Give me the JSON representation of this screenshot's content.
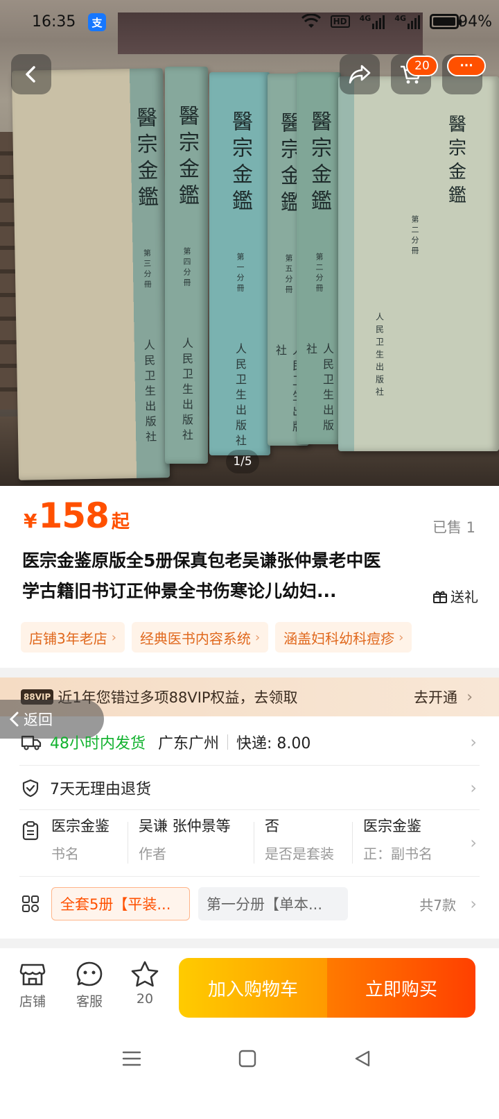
{
  "status_bar": {
    "time": "16:35",
    "alipay_glyph": "支",
    "hd_label": "HD",
    "net_label": "4G",
    "battery": "94%"
  },
  "photo": {
    "books": [
      {
        "title": "醫宗金鑑",
        "volume": "第三分冊",
        "publisher": "人民卫生出版社"
      },
      {
        "title": "醫宗金鑑",
        "volume": "第四分冊",
        "publisher": "人民卫生出版社"
      },
      {
        "title": "醫宗金鑑",
        "volume": "第一分冊",
        "publisher": "人民卫生出版社"
      },
      {
        "title": "醫宗金鑑",
        "volume": "第五分冊",
        "publisher": "人民卫生出版社"
      },
      {
        "title": "醫宗金鑑",
        "volume": "第二分冊",
        "publisher": "人民卫生出版社"
      },
      {
        "title": "醫宗金鑑",
        "volume": "第二分冊",
        "publisher": "人民卫生出版社"
      }
    ],
    "counter": "1/5"
  },
  "header": {
    "cart_badge": "20",
    "more_badge": "···"
  },
  "product": {
    "currency": "¥",
    "price": "158",
    "price_suffix": "起",
    "sold": "已售 1",
    "title_line1": "医宗金鉴原版全5册保真包老吴谦张仲景老中医",
    "title_line2": "学古籍旧书订正仲景全书伤寒论儿幼妇...",
    "gift_label": "送礼",
    "tags": [
      "店铺3年老店",
      "经典医书内容系统",
      "涵盖妇科幼科痘疹"
    ]
  },
  "vip": {
    "badge": "88VIP",
    "text": "近1年您错过多项88VIP权益，去领取",
    "action": "去开通"
  },
  "back_float": {
    "label": "返回"
  },
  "shipping": {
    "time": "48小时内发货",
    "location": "广东广州",
    "express": "快递: 8.00"
  },
  "returns": {
    "text": "7天无理由退货"
  },
  "params": [
    {
      "value": "医宗金鉴",
      "key": "书名"
    },
    {
      "value": "吴谦 张仲景等",
      "key": "作者"
    },
    {
      "value": "否",
      "key": "是否是套装"
    },
    {
      "value": "医宗金鉴",
      "key": "正：副书名"
    }
  ],
  "sku": {
    "selected": "全套5册【平装...",
    "other": "第一分册【单本...",
    "count": "共7款"
  },
  "bottom_bar": {
    "shop": "店铺",
    "service": "客服",
    "favorites_count": "20",
    "add_to_cart": "加入购物车",
    "buy_now": "立即购买"
  },
  "colors": {
    "accent": "#ff5000",
    "green": "#12b22f",
    "cart_gradient": "#ffcb00",
    "buy_gradient": "#ff4000"
  }
}
